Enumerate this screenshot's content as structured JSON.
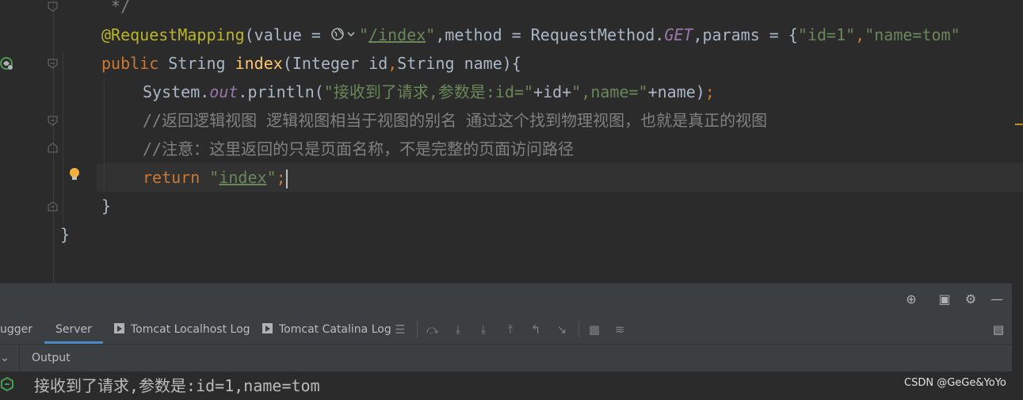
{
  "editor": {
    "lines": {
      "l0": {
        "comment_end": " */"
      },
      "l1": {
        "annotation": "@RequestMapping",
        "p1": "(value = ",
        "q1": "\"",
        "path": "/index",
        "q2": "\"",
        "p2": ",method = RequestMethod.",
        "get": "GET",
        "p3": ",params = {",
        "s1": "\"id=1\"",
        "p4": ",",
        "s2": "\"name=tom\""
      },
      "l2": {
        "kw": "public",
        "p1": " String ",
        "fn": "index",
        "p2": "(Integer id",
        "comma": ",",
        "p3": "String name){"
      },
      "l3": {
        "p1": "System.",
        "field": "out",
        "p2": ".println(",
        "s1": "\"接收到了请求,参数是:id=\"",
        "p3": "+id+",
        "s2": "\",name=\"",
        "p4": "+name)",
        "semi": ";"
      },
      "l4": {
        "comment": "//返回逻辑视图 逻辑视图相当于视图的别名 通过这个找到物理视图，也就是真正的视图"
      },
      "l5": {
        "comment": "//注意：这里返回的只是页面名称，不是完整的页面访问路径"
      },
      "l6": {
        "kw": "return",
        "q1": "\"",
        "str": "index",
        "q2": "\"",
        "semi": ";"
      },
      "l7": {
        "brace": "}"
      },
      "l8": {
        "brace": "}"
      }
    }
  },
  "panel": {
    "tabs": {
      "debugger": "ugger",
      "server": "Server",
      "localhost_log": "Tomcat Localhost Log",
      "catalina_log": "Tomcat Catalina Log"
    },
    "output_label": "Output",
    "output_text": "接收到了请求,参数是:id=1,name=tom"
  },
  "watermark": "CSDN @GeGe&YoYo",
  "colors": {
    "background": "#2b2b2b",
    "annotation": "#bbb529",
    "keyword": "#cc7832",
    "function": "#ffc66d",
    "string": "#6a8759",
    "comment": "#808080",
    "field": "#9876aa",
    "accent": "#4a88c7"
  }
}
